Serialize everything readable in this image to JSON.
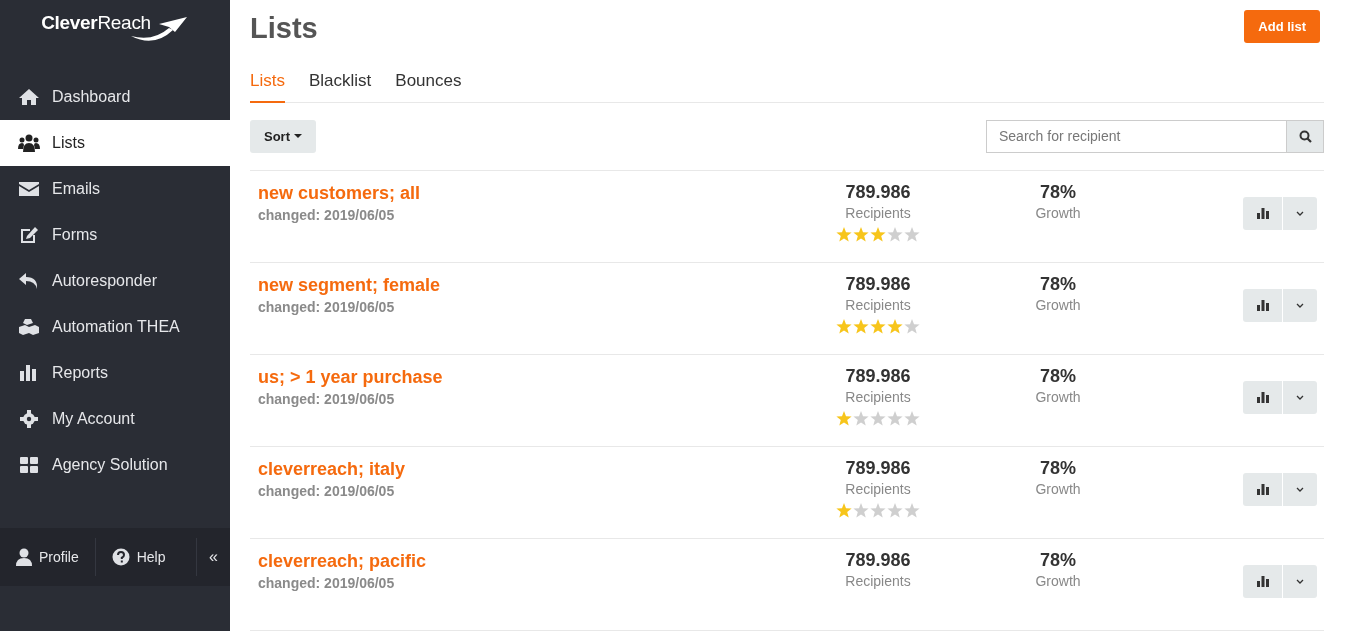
{
  "logo": "**Clever**Reach",
  "sidebar": {
    "items": [
      {
        "label": "Dashboard",
        "selected": false
      },
      {
        "label": "Lists",
        "selected": true
      },
      {
        "label": "Emails",
        "selected": false
      },
      {
        "label": "Forms",
        "selected": false
      },
      {
        "label": "Autoresponder",
        "selected": false
      },
      {
        "label": "Automation THEA",
        "selected": false
      },
      {
        "label": "Reports",
        "selected": false
      },
      {
        "label": "My Account",
        "selected": false
      },
      {
        "label": "Agency Solution",
        "selected": false
      }
    ],
    "footer": {
      "profile": "Profile",
      "help": "Help",
      "collapse": "«"
    }
  },
  "page": {
    "title": "Lists",
    "add_button": "Add list"
  },
  "tabs": [
    {
      "label": "Lists",
      "selected": true
    },
    {
      "label": "Blacklist",
      "selected": false
    },
    {
      "label": "Bounces",
      "selected": false
    }
  ],
  "toolbar": {
    "sort": "Sort",
    "search": {
      "placeholder": "Search for recipient"
    }
  },
  "lists": [
    {
      "name": "new customers; all",
      "changed": "changed: 2019/06/05",
      "recipients": "789.986",
      "recipients_label": "Recipients",
      "growth": "78%",
      "growth_label": "Growth",
      "stars": 3
    },
    {
      "name": "new segment; female",
      "changed": "changed: 2019/06/05",
      "recipients": "789.986",
      "recipients_label": "Recipients",
      "growth": "78%",
      "growth_label": "Growth",
      "stars": 4
    },
    {
      "name": "us; > 1 year purchase",
      "changed": "changed: 2019/06/05",
      "recipients": "789.986",
      "recipients_label": "Recipients",
      "growth": "78%",
      "growth_label": "Growth",
      "stars": 1
    },
    {
      "name": "cleverreach; italy",
      "changed": "changed: 2019/06/05",
      "recipients": "789.986",
      "recipients_label": "Recipients",
      "growth": "78%",
      "growth_label": "Growth",
      "stars": 1
    },
    {
      "name": "cleverreach; pacific",
      "changed": "changed: 2019/06/05",
      "recipients": "789.986",
      "recipients_label": "Recipients",
      "growth": "78%",
      "growth_label": "Growth"
    }
  ]
}
